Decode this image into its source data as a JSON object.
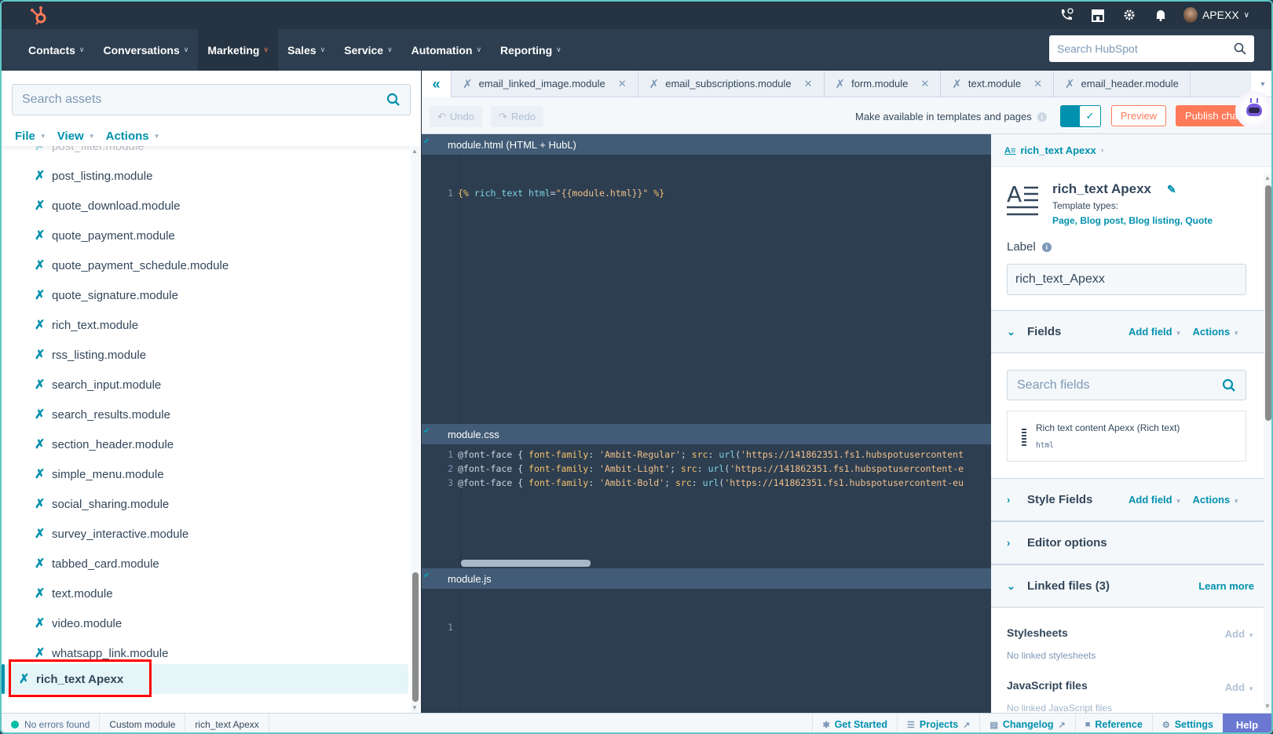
{
  "topbar": {
    "logo": "hubspot-sprocket-logo",
    "icons": [
      "phone-icon",
      "marketplace-icon",
      "gear-icon",
      "bell-icon"
    ],
    "account_name": "APEXX"
  },
  "nav": {
    "items": [
      {
        "label": "Contacts",
        "active": false
      },
      {
        "label": "Conversations",
        "active": false
      },
      {
        "label": "Marketing",
        "active": true
      },
      {
        "label": "Sales",
        "active": false
      },
      {
        "label": "Service",
        "active": false
      },
      {
        "label": "Automation",
        "active": false
      },
      {
        "label": "Reporting",
        "active": false
      }
    ],
    "search_placeholder": "Search HubSpot"
  },
  "left_panel": {
    "search_placeholder": "Search assets",
    "menus": [
      "File",
      "View",
      "Actions"
    ],
    "tree_items": [
      "post_filter.module",
      "post_listing.module",
      "quote_download.module",
      "quote_payment.module",
      "quote_payment_schedule.module",
      "quote_signature.module",
      "rich_text.module",
      "rss_listing.module",
      "search_input.module",
      "search_results.module",
      "section_header.module",
      "simple_menu.module",
      "social_sharing.module",
      "survey_interactive.module",
      "tabbed_card.module",
      "text.module",
      "video.module",
      "whatsapp_link.module"
    ],
    "selected_item": "rich_text Apexx"
  },
  "tabs": [
    "email_linked_image.module",
    "email_subscriptions.module",
    "form.module",
    "text.module",
    "email_header.module"
  ],
  "toolbar": {
    "undo": "Undo",
    "redo": "Redo",
    "availability_label": "Make available in templates and pages",
    "availability_enabled": true,
    "preview": "Preview",
    "publish": "Publish changes"
  },
  "editor": {
    "html_pane": {
      "title": "module.html (HTML + HubL)",
      "lines": [
        "{% rich_text html=\"{{module.html}}\" %}"
      ]
    },
    "css_pane": {
      "title": "module.css",
      "lines": [
        {
          "n": "1",
          "family": "'Ambit-Regular'",
          "url": "'https://141862351.fs1.hubspotusercontent"
        },
        {
          "n": "2",
          "family": "'Ambit-Light'",
          "url": "'https://141862351.fs1.hubspotusercontent-e"
        },
        {
          "n": "3",
          "family": "'Ambit-Bold'",
          "url": "'https://141862351.fs1.hubspotusercontent-eu"
        }
      ]
    },
    "js_pane": {
      "title": "module.js",
      "lines": [
        ""
      ]
    }
  },
  "right_panel": {
    "breadcrumb": "rich_text Apexx",
    "title": "rich_text Apexx",
    "template_types_label": "Template types:",
    "template_types": "Page, Blog post, Blog listing, Quote",
    "label_heading": "Label",
    "label_value": "rich_text_Apexx",
    "fields_section": {
      "title": "Fields",
      "add_field": "Add field",
      "actions": "Actions"
    },
    "fields_search_placeholder": "Search fields",
    "field": {
      "name": "Rich text content Apexx (Rich text)",
      "key": "html"
    },
    "style_fields_section": {
      "title": "Style Fields",
      "add_field": "Add field",
      "actions": "Actions"
    },
    "editor_options": "Editor options",
    "linked_files": {
      "title": "Linked files (3)",
      "learn_more": "Learn more"
    },
    "stylesheets": {
      "title": "Stylesheets",
      "add": "Add",
      "empty": "No linked stylesheets"
    },
    "javascript_files": {
      "title": "JavaScript files",
      "add": "Add",
      "empty": "No linked JavaScript files"
    }
  },
  "status_bar": {
    "errors": "No errors found",
    "type": "Custom module",
    "name": "rich_text Apexx",
    "links": [
      "Get Started",
      "Projects",
      "Changelog",
      "Reference",
      "Settings"
    ],
    "help": "Help"
  },
  "colors": {
    "accent": "#0091ae",
    "cta": "#ff7a59",
    "nav_bg": "#2d3e50",
    "help": "#6a78d1",
    "ok": "#00bda5"
  }
}
